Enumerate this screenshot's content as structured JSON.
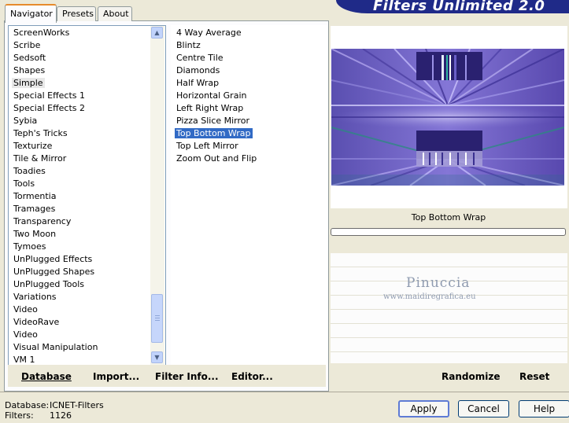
{
  "banner": {
    "title": "Filters Unlimited 2.0"
  },
  "tabs": [
    {
      "label": "Navigator",
      "active": true
    },
    {
      "label": "Presets",
      "active": false
    },
    {
      "label": "About",
      "active": false
    }
  ],
  "categories": {
    "items": [
      "ScreenWorks",
      "Scribe",
      "Sedsoft",
      "Shapes",
      "Simple",
      "Special Effects 1",
      "Special Effects 2",
      "Sybia",
      "Teph's Tricks",
      "Texturize",
      "Tile & Mirror",
      "Toadies",
      "Tools",
      "Tormentia",
      "Tramages",
      "Transparency",
      "Two Moon",
      "Tymoes",
      "UnPlugged Effects",
      "UnPlugged Shapes",
      "UnPlugged Tools",
      "Variations",
      "Video",
      "VideoRave",
      "Video",
      "Visual Manipulation",
      "VM 1"
    ],
    "selected": "Simple"
  },
  "filters": {
    "items": [
      "4 Way Average",
      "Blintz",
      "Centre Tile",
      "Diamonds",
      "Half Wrap",
      "Horizontal Grain",
      "Left Right Wrap",
      "Pizza Slice Mirror",
      "Top Bottom Wrap",
      "Top Left Mirror",
      "Zoom Out and Flip"
    ],
    "selected": "Top Bottom Wrap"
  },
  "buttons_bar": {
    "database": "Database",
    "import": "Import...",
    "filter_info": "Filter Info...",
    "editor": "Editor...",
    "randomize": "Randomize",
    "reset": "Reset"
  },
  "preview": {
    "filter_name": "Top Bottom Wrap",
    "progress": 0
  },
  "watermark": {
    "name": "Pinuccia",
    "url": "www.maidiregrafica.eu"
  },
  "footer": {
    "database_label": "Database:",
    "database_value": "ICNET-Filters",
    "filters_label": "Filters:",
    "filters_value": "1126",
    "apply": "Apply",
    "cancel": "Cancel",
    "help": "Help"
  },
  "colors": {
    "selection": "#316ac5",
    "banner": "#1f2a88",
    "tab_accent": "#e68b2c"
  }
}
